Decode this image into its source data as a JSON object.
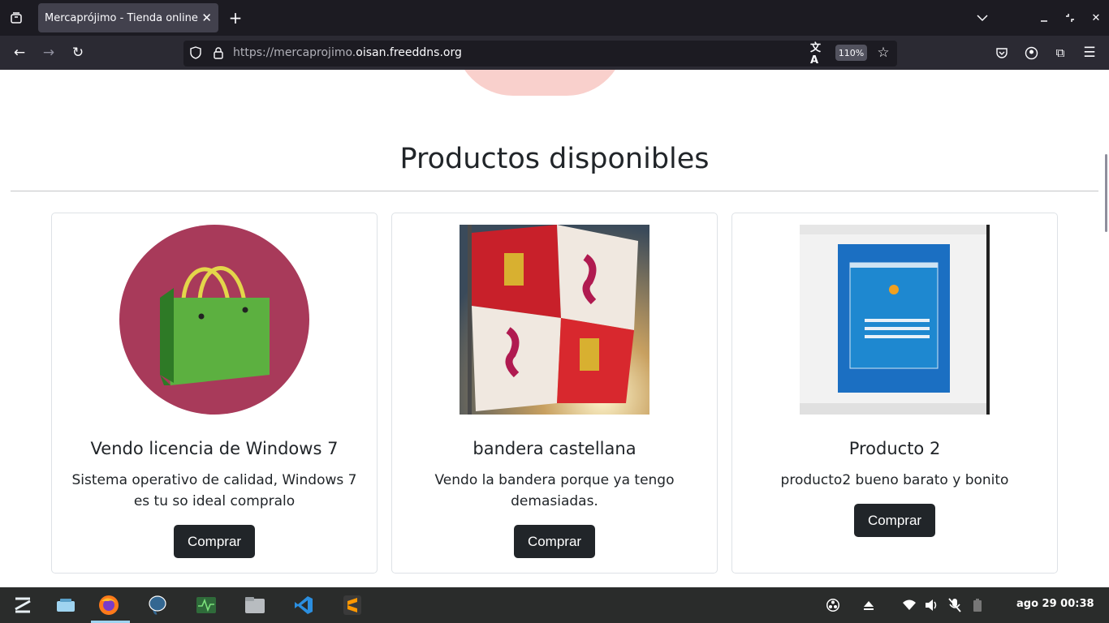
{
  "browser": {
    "tab_title": "Mercaprójimo - Tienda online",
    "url_prefix": "https://mercaprojimo.",
    "url_host": "oisan.freeddns.org",
    "zoom": "110%",
    "icons": [
      "tab-overview-icon",
      "close-icon",
      "new-tab-icon",
      "chevron-down-icon",
      "minimize-icon",
      "restore-icon",
      "window-close-icon",
      "back-icon",
      "forward-icon",
      "reload-icon",
      "shield-icon",
      "lock-icon",
      "translate-icon",
      "bookmark-star-icon",
      "pocket-icon",
      "account-icon",
      "extensions-icon",
      "menu-icon"
    ]
  },
  "page": {
    "section_title": "Productos disponibles",
    "products": [
      {
        "title": "Vendo licencia de Windows 7",
        "description": "Sistema operativo de calidad, Windows 7 es tu so ideal compralo",
        "button": "Comprar",
        "image": "shopping-bag-image"
      },
      {
        "title": "bandera castellana",
        "description": "Vendo la bandera porque ya tengo demasiadas.",
        "button": "Comprar",
        "image": "castile-flag-image"
      },
      {
        "title": "Producto 2",
        "description": "producto2 bueno barato y bonito",
        "button": "Comprar",
        "image": "windows7-install-screenshot"
      }
    ]
  },
  "taskbar": {
    "apps": [
      "zorin-menu-icon",
      "workspaces-icon",
      "firefox-icon",
      "postgresql-icon",
      "system-monitor-icon",
      "files-icon",
      "vscode-icon",
      "sublime-text-icon"
    ],
    "tray": [
      "obs-icon",
      "eject-icon",
      "wifi-icon",
      "volume-icon",
      "mic-muted-icon",
      "battery-icon"
    ],
    "clock": "ago 29  00:38"
  },
  "colors": {
    "accent": "#212529",
    "bag_circle": "#a83a5a",
    "bag_green": "#55a840"
  }
}
